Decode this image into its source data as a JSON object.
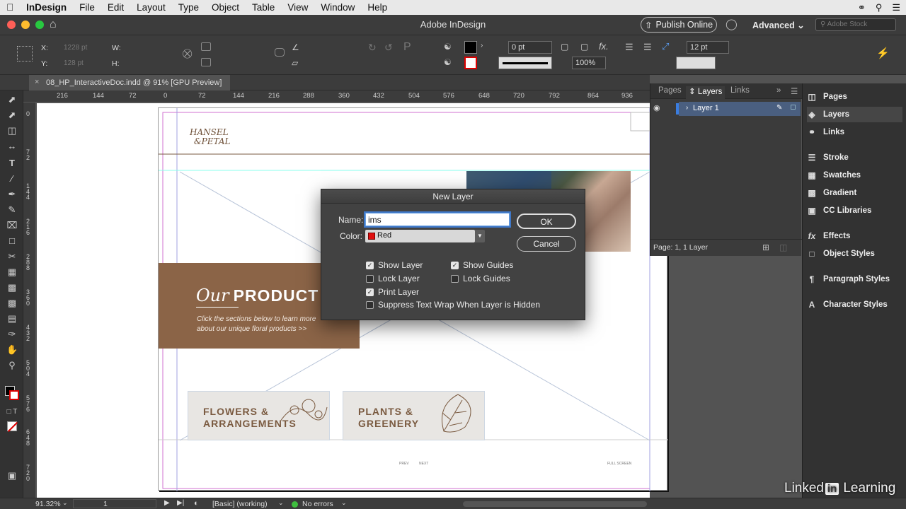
{
  "menubar": {
    "app": "InDesign",
    "items": [
      "File",
      "Edit",
      "Layout",
      "Type",
      "Object",
      "Table",
      "View",
      "Window",
      "Help"
    ]
  },
  "titlebar": {
    "title": "Adobe InDesign",
    "publish": "Publish Online",
    "workspace": "Advanced",
    "search_placeholder": "Adobe Stock"
  },
  "control": {
    "x_label": "X:",
    "x_value": "1228 pt",
    "y_label": "Y:",
    "y_value": "128 pt",
    "w_label": "W:",
    "h_label": "H:",
    "stroke_weight": "0 pt",
    "zoom": "100%",
    "measure": "12 pt"
  },
  "tab": {
    "doc_title": "08_HP_InteractiveDoc.indd @ 91% [GPU Preview]"
  },
  "ruler": {
    "h": [
      "216",
      "144",
      "72",
      "0",
      "72",
      "144",
      "216",
      "288",
      "360",
      "432",
      "504",
      "576",
      "648",
      "720",
      "792",
      "864",
      "936"
    ],
    "v": [
      "0",
      "72",
      "144",
      "216",
      "288",
      "360",
      "432",
      "504",
      "576",
      "648",
      "720"
    ]
  },
  "document": {
    "logo_line1": "HANSEL",
    "logo_line2": "&PETAL",
    "hero_script": "Our",
    "hero_title": "PRODUCT",
    "hero_sub1": "Click the sections below to learn more",
    "hero_sub2": "about our unique floral products >>",
    "tile1_l1": "FLOWERS &",
    "tile1_l2": "ARRANGEMENTS",
    "tile2_l1": "PLANTS &",
    "tile2_l2": "GREENERY",
    "foot_prev": "PREV",
    "foot_next": "NEXT",
    "foot_full": "FULL SCREEN"
  },
  "layers_panel": {
    "tabs": [
      "Pages",
      "Layers",
      "Links"
    ],
    "layer": "Layer 1",
    "footer": "Page: 1, 1 Layer"
  },
  "dock": [
    "Pages",
    "Layers",
    "Links",
    "Stroke",
    "Swatches",
    "Gradient",
    "CC Libraries",
    "Effects",
    "Object Styles",
    "Paragraph Styles",
    "Character Styles"
  ],
  "dialog": {
    "title": "New Layer",
    "name_label": "Name:",
    "name_value": "ims",
    "color_label": "Color:",
    "color_value": "Red",
    "ok": "OK",
    "cancel": "Cancel",
    "show_layer": "Show Layer",
    "lock_layer": "Lock Layer",
    "print_layer": "Print Layer",
    "show_guides": "Show Guides",
    "lock_guides": "Lock Guides",
    "suppress": "Suppress Text Wrap When Layer is Hidden"
  },
  "status": {
    "zoom": "91.32%",
    "page": "1",
    "style": "[Basic] (working)",
    "errors": "No errors"
  },
  "watermark": {
    "text1": "Linked",
    "text2": "in",
    "text3": "Learning"
  },
  "colors": {
    "layer_color": "#e01010",
    "accent": "#4a5f80",
    "brown": "#8b6447"
  }
}
